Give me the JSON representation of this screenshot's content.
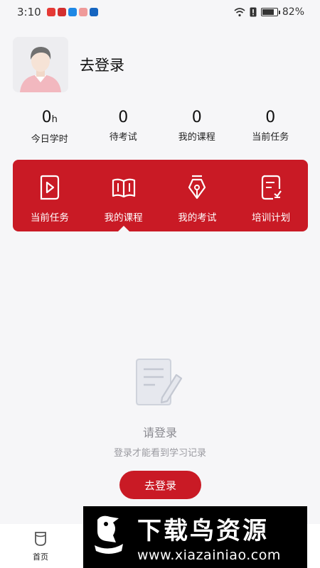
{
  "status_bar": {
    "time": "3:10",
    "battery_percent": "82%",
    "battery_level": 0.82
  },
  "profile": {
    "login_text": "去登录"
  },
  "stats": [
    {
      "value": "0",
      "unit": "h",
      "label": "今日学时"
    },
    {
      "value": "0",
      "unit": "",
      "label": "待考试"
    },
    {
      "value": "0",
      "unit": "",
      "label": "我的课程"
    },
    {
      "value": "0",
      "unit": "",
      "label": "当前任务"
    }
  ],
  "menu": [
    {
      "label": "当前任务",
      "icon": "play-document-icon"
    },
    {
      "label": "我的课程",
      "icon": "open-book-icon"
    },
    {
      "label": "我的考试",
      "icon": "pen-nib-icon"
    },
    {
      "label": "培训计划",
      "icon": "plan-document-icon"
    }
  ],
  "empty_state": {
    "title": "请登录",
    "subtitle": "登录才能看到学习记录",
    "button_label": "去登录",
    "icon": "document-pencil-icon"
  },
  "bottom_nav": {
    "home_label": "首页"
  },
  "watermark": {
    "cn": "下载鸟资源",
    "url": "www.xiazainiao.com"
  },
  "colors": {
    "accent": "#c91a25",
    "background": "#f6f6f8"
  }
}
